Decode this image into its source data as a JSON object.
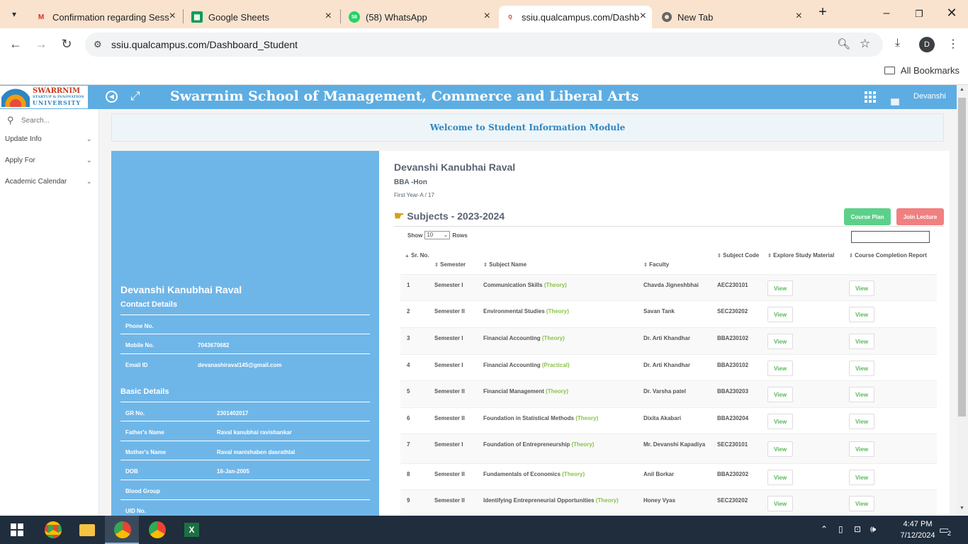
{
  "browser": {
    "tabs": [
      {
        "title": "Confirmation regarding Sess",
        "icon": "gmail-icon"
      },
      {
        "title": "Google Sheets",
        "icon": "sheets-icon"
      },
      {
        "title": "(58) WhatsApp",
        "icon": "whatsapp-icon",
        "badge": "58"
      },
      {
        "title": "ssiu.qualcampus.com/Dashb",
        "icon": "qualcampus-icon",
        "active": true
      },
      {
        "title": "New Tab",
        "icon": "chrome-icon"
      }
    ],
    "url": "ssiu.qualcampus.com/Dashboard_Student",
    "profile_initial": "D",
    "bookmarks_label": "All Bookmarks"
  },
  "header": {
    "logo_line1": "SWARRNIM",
    "logo_line2": "STARTUP & INNOVATION",
    "logo_line3": "UNIVERSITY",
    "school_name": "Swarrnim School of Management, Commerce and Liberal Arts",
    "user": "Devanshi"
  },
  "sidebar": {
    "search_placeholder": "Search...",
    "items": [
      {
        "label": "Update Info"
      },
      {
        "label": "Apply For"
      },
      {
        "label": "Academic Calendar"
      }
    ]
  },
  "welcome": "Welcome to Student Information Module",
  "profile": {
    "name": "Devanshi Kanubhai Raval",
    "contact_title": "Contact Details",
    "contact": [
      {
        "k": "Phone No.",
        "v": ""
      },
      {
        "k": "Mobile No.",
        "v": "7043670682"
      },
      {
        "k": "Email ID",
        "v": "devanashiraval145@gmail.com"
      }
    ],
    "basic_title": "Basic Details",
    "basic": [
      {
        "k": "GR No.",
        "v": "2301402017"
      },
      {
        "k": "Father's Name",
        "v": "Raval kanubhai ravishankar"
      },
      {
        "k": "Mother's Name",
        "v": "Raval manishaben dasrathlal"
      },
      {
        "k": "DOB",
        "v": "16-Jan-2005"
      },
      {
        "k": "Blood Group",
        "v": ""
      },
      {
        "k": "UID No.",
        "v": ""
      }
    ]
  },
  "student": {
    "name": "Devanshi Kanubhai Raval",
    "course": "BBA -Hon",
    "division": "First Year-A / 17",
    "subjects_title": "Subjects - 2023-2024",
    "course_plan_label": "Course Plan",
    "join_lecture_label": "Join Lecture",
    "course_plan_color": "#5cd08a",
    "join_lecture_color": "#f08080"
  },
  "table": {
    "show_label": "Show",
    "rows_label": "Rows",
    "page_size": "10",
    "headers": [
      "Sr. No.",
      "Semester",
      "Subject Name",
      "Faculty",
      "Subject Code",
      "Explore Study Material",
      "Course Completion Report"
    ],
    "view_label": "View",
    "rows": [
      {
        "no": "1",
        "sem": "Semester I",
        "subject": "Communication Skills",
        "type": "(Theory)",
        "faculty": "Chavda Jigneshbhai",
        "code": "AEC230101"
      },
      {
        "no": "2",
        "sem": "Semester II",
        "subject": "Environmental Studies",
        "type": "(Theory)",
        "faculty": "Savan Tank",
        "code": "SEC230202"
      },
      {
        "no": "3",
        "sem": "Semester I",
        "subject": "Financial Accounting",
        "type": "(Theory)",
        "faculty": "Dr. Arti Khandhar",
        "code": "BBA230102"
      },
      {
        "no": "4",
        "sem": "Semester I",
        "subject": "Financial Accounting",
        "type": "(Practical)",
        "faculty": "Dr. Arti Khandhar",
        "code": "BBA230102"
      },
      {
        "no": "5",
        "sem": "Semester II",
        "subject": "Financial Management",
        "type": "(Theory)",
        "faculty": "Dr. Varsha patel",
        "code": "BBA230203"
      },
      {
        "no": "6",
        "sem": "Semester II",
        "subject": "Foundation in Statistical Methods",
        "type": "(Theory)",
        "faculty": "Dixita Akabari",
        "code": "BBA230204"
      },
      {
        "no": "7",
        "sem": "Semester I",
        "subject": "Foundation of Entrepreneurship",
        "type": "(Theory)",
        "faculty": "Mr. Devanshi Kapadiya",
        "code": "SEC230101"
      },
      {
        "no": "8",
        "sem": "Semester II",
        "subject": "Fundamentals of Economics",
        "type": "(Theory)",
        "faculty": "Anil Borkar",
        "code": "BBA230202"
      },
      {
        "no": "9",
        "sem": "Semester II",
        "subject": "Identifying Entrepreneurial Opportunities",
        "type": "(Theory)",
        "faculty": "Honey Vyas",
        "code": "SEC230202"
      }
    ]
  },
  "taskbar": {
    "time": "4:47 PM",
    "date": "7/12/2024",
    "notifications": "2"
  }
}
